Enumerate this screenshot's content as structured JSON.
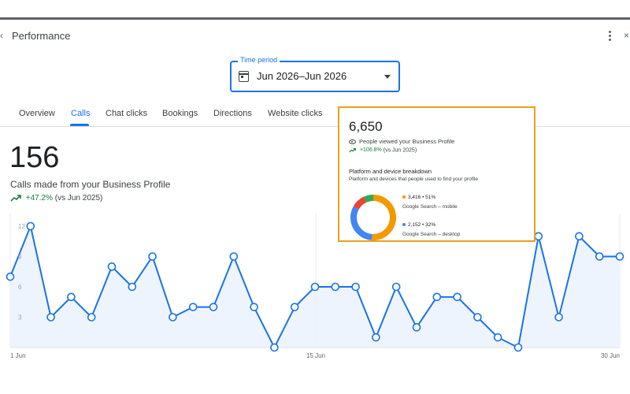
{
  "header": {
    "title": "Performance"
  },
  "time_period": {
    "label": "Time period",
    "value": "Jun 2026–Jun 2026"
  },
  "tabs": [
    {
      "label": "Overview",
      "active": false
    },
    {
      "label": "Calls",
      "active": true
    },
    {
      "label": "Chat clicks",
      "active": false
    },
    {
      "label": "Bookings",
      "active": false
    },
    {
      "label": "Directions",
      "active": false
    },
    {
      "label": "Website clicks",
      "active": false
    }
  ],
  "summary": {
    "value": "156",
    "description": "Calls made from your Business Profile",
    "change": "+47.2%",
    "comparison": "(vs Jun 2025)",
    "trend_color": "#188038"
  },
  "popup": {
    "total": "6,650",
    "total_label": "People viewed your Business Profile",
    "change": "+106.8%",
    "comparison": "(vs Jun 2025)",
    "breakdown_title": "Platform and device breakdown",
    "breakdown_subtitle": "Platform and devices that people used to find your profile",
    "legend": [
      {
        "value": "3,416 • 51%",
        "name": "Google Search – mobile",
        "color": "#f29900"
      },
      {
        "value": "2,152 • 32%",
        "name": "Google Search – desktop",
        "color": "#4285f4"
      }
    ]
  },
  "chart_data": {
    "type": "line",
    "title": "",
    "xlabel": "",
    "ylabel": "",
    "x_tick_labels": [
      "1 Jun",
      "15 Jun",
      "30 Jun"
    ],
    "y_tick_labels": [
      "3",
      "6",
      "9",
      "12"
    ],
    "ylim": [
      0,
      12
    ],
    "x": [
      1,
      2,
      3,
      4,
      5,
      6,
      7,
      8,
      9,
      10,
      11,
      12,
      13,
      14,
      15,
      16,
      17,
      18,
      19,
      20,
      21,
      22,
      23,
      24,
      25,
      26,
      27,
      28,
      29,
      30,
      31
    ],
    "series": [
      {
        "values": [
          7,
          12,
          3,
          5,
          3,
          8,
          6,
          9,
          3,
          4,
          4,
          9,
          4,
          0,
          4,
          6,
          6,
          6,
          1,
          6,
          2,
          5,
          5,
          3,
          1,
          0,
          11,
          3,
          11,
          9,
          9
        ],
        "color": "#1a73e8"
      }
    ],
    "grid": true
  },
  "donut_data": {
    "type": "pie",
    "slices": [
      {
        "value": 51,
        "color": "#f29900"
      },
      {
        "value": 32,
        "color": "#4285f4"
      },
      {
        "value": 10,
        "color": "#ea4335"
      },
      {
        "value": 7,
        "color": "#34a853"
      }
    ]
  }
}
